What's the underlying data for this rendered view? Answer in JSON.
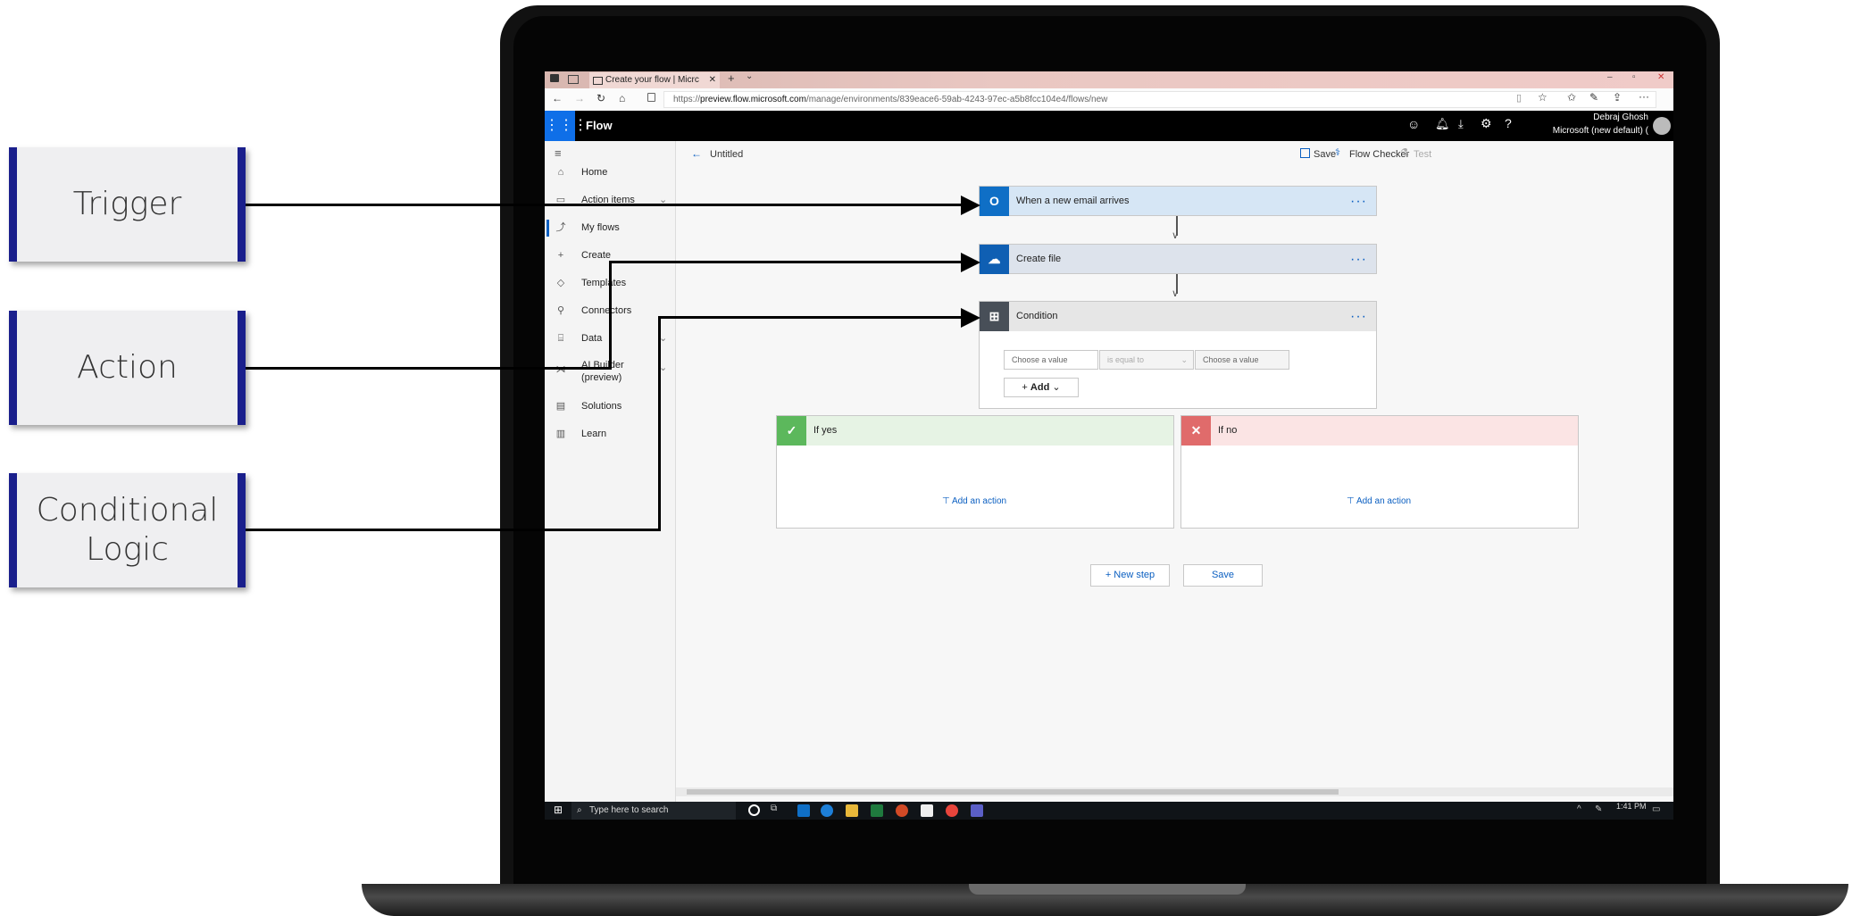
{
  "callouts": {
    "trigger": "Trigger",
    "action": "Action",
    "conditional_line1": "Conditional",
    "conditional_line2": "Logic"
  },
  "browser": {
    "tab_title": "Create your flow | Micrc",
    "url_prefix": "https://",
    "url_domain": "preview.flow.microsoft.com",
    "url_path": "/manage/environments/839eace6-59ab-4243-97ec-a5b8fcc104e4/flows/new"
  },
  "app": {
    "name": "Flow",
    "user_name": "Debraj Ghosh",
    "user_org": "Microsoft (new default) ("
  },
  "sidebar": {
    "items": [
      {
        "label": "Home",
        "icon": "home-icon"
      },
      {
        "label": "Action items",
        "icon": "clipboard-icon"
      },
      {
        "label": "My flows",
        "icon": "flow-icon"
      },
      {
        "label": "Create",
        "icon": "plus-icon"
      },
      {
        "label": "Templates",
        "icon": "templates-icon"
      },
      {
        "label": "Connectors",
        "icon": "connector-icon"
      },
      {
        "label": "Data",
        "icon": "database-icon"
      },
      {
        "label": "AI Builder",
        "icon": "ai-builder-icon"
      },
      {
        "label": "Solutions",
        "icon": "solutions-icon"
      },
      {
        "label": "Learn",
        "icon": "book-icon"
      }
    ],
    "ai_builder_sub": "(preview)"
  },
  "editor": {
    "title": "Untitled",
    "save": "Save",
    "flow_checker": "Flow Checker",
    "test": "Test"
  },
  "steps": {
    "trigger": "When a new email arrives",
    "create_file": "Create file",
    "condition": "Condition",
    "choose_value_left": "Choose a value",
    "operator": "is equal to",
    "choose_value_right": "Choose a value",
    "add": "Add",
    "if_yes": "If yes",
    "if_no": "If no",
    "add_action": "Add an action",
    "new_step": "+ New step",
    "save": "Save"
  },
  "taskbar": {
    "search_placeholder": "Type here to search",
    "time": "1:41 PM"
  },
  "colors": {
    "callout_border": "#1a1f8c",
    "outlook": "#0f6fc6",
    "onedrive": "#0f5fb3",
    "condition": "#484f58",
    "yes": "#5cb85c",
    "no": "#e06b6b",
    "accent": "#0b5fc1"
  }
}
